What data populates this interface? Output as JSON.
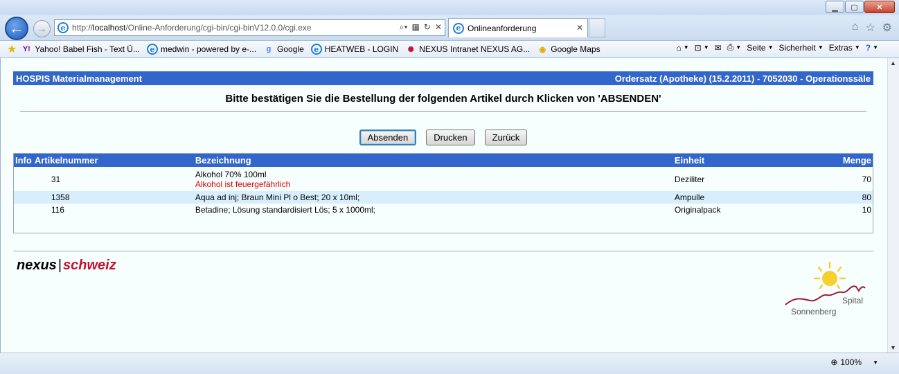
{
  "browser": {
    "url_prefix": "http://",
    "url_host": "localhost",
    "url_path": "/Online-Anforderung/cgi-bin/cgi-binV12.0.0/cgi.exe",
    "tab_title": "Onlineanforderung",
    "favorites": [
      {
        "label": "Yahoo! Babel Fish - Text Ü...",
        "icon": "yahoo-icon",
        "color": "#7b0099"
      },
      {
        "label": "medwin - powered by e-...",
        "icon": "ie-page-icon",
        "color": "#1f7fd6"
      },
      {
        "label": "Google",
        "icon": "google-icon",
        "color": "#4285f4"
      },
      {
        "label": "HEATWEB - LOGIN",
        "icon": "ie-page-icon",
        "color": "#1f7fd6"
      },
      {
        "label": "NEXUS Intranet NEXUS AG...",
        "icon": "nexus-icon",
        "color": "#c4102f"
      },
      {
        "label": "Google Maps",
        "icon": "maps-icon",
        "color": "#e8a800"
      }
    ],
    "commands": {
      "page": "Seite",
      "safety": "Sicherheit",
      "extras": "Extras"
    },
    "zoom": "100%"
  },
  "page": {
    "app_title": "HOSPIS Materialmanagement",
    "order_info": "Ordersatz (Apotheke) (15.2.2011) - 7052030 - Operationssäle",
    "headline": "Bitte bestätigen Sie die Bestellung der folgenden Artikel durch Klicken von 'ABSENDEN'",
    "buttons": {
      "send": "Absenden",
      "print": "Drucken",
      "back": "Zurück"
    },
    "table": {
      "headers": {
        "info": "Info",
        "article_number": "Artikelnummer",
        "description": "Bezeichnung",
        "unit": "Einheit",
        "quantity": "Menge"
      },
      "rows": [
        {
          "number": "31",
          "description": "Alkohol 70% 100ml",
          "warning": "Alkohol ist feuergefährlich",
          "unit": "Deziliter",
          "quantity": "70"
        },
        {
          "number": "1358",
          "description": "Aqua ad inj; Braun Mini Pl o Best; 20 x 10ml;",
          "unit": "Ampulle",
          "quantity": "80"
        },
        {
          "number": "116",
          "description": "Betadine; Lösung standardisiert Lös; 5 x 1000ml;",
          "unit": "Originalpack",
          "quantity": "10"
        }
      ]
    },
    "footer": {
      "nexus_part1": "nexus",
      "nexus_sep": "|",
      "nexus_part2": "schweiz",
      "spital_top": "Spital",
      "spital_bottom": "Sonnenberg"
    }
  },
  "colors": {
    "header_blue": "#3366cc",
    "row_highlight": "#d9eefc",
    "warning_red": "#e00000",
    "nexus_red": "#c4102f"
  }
}
